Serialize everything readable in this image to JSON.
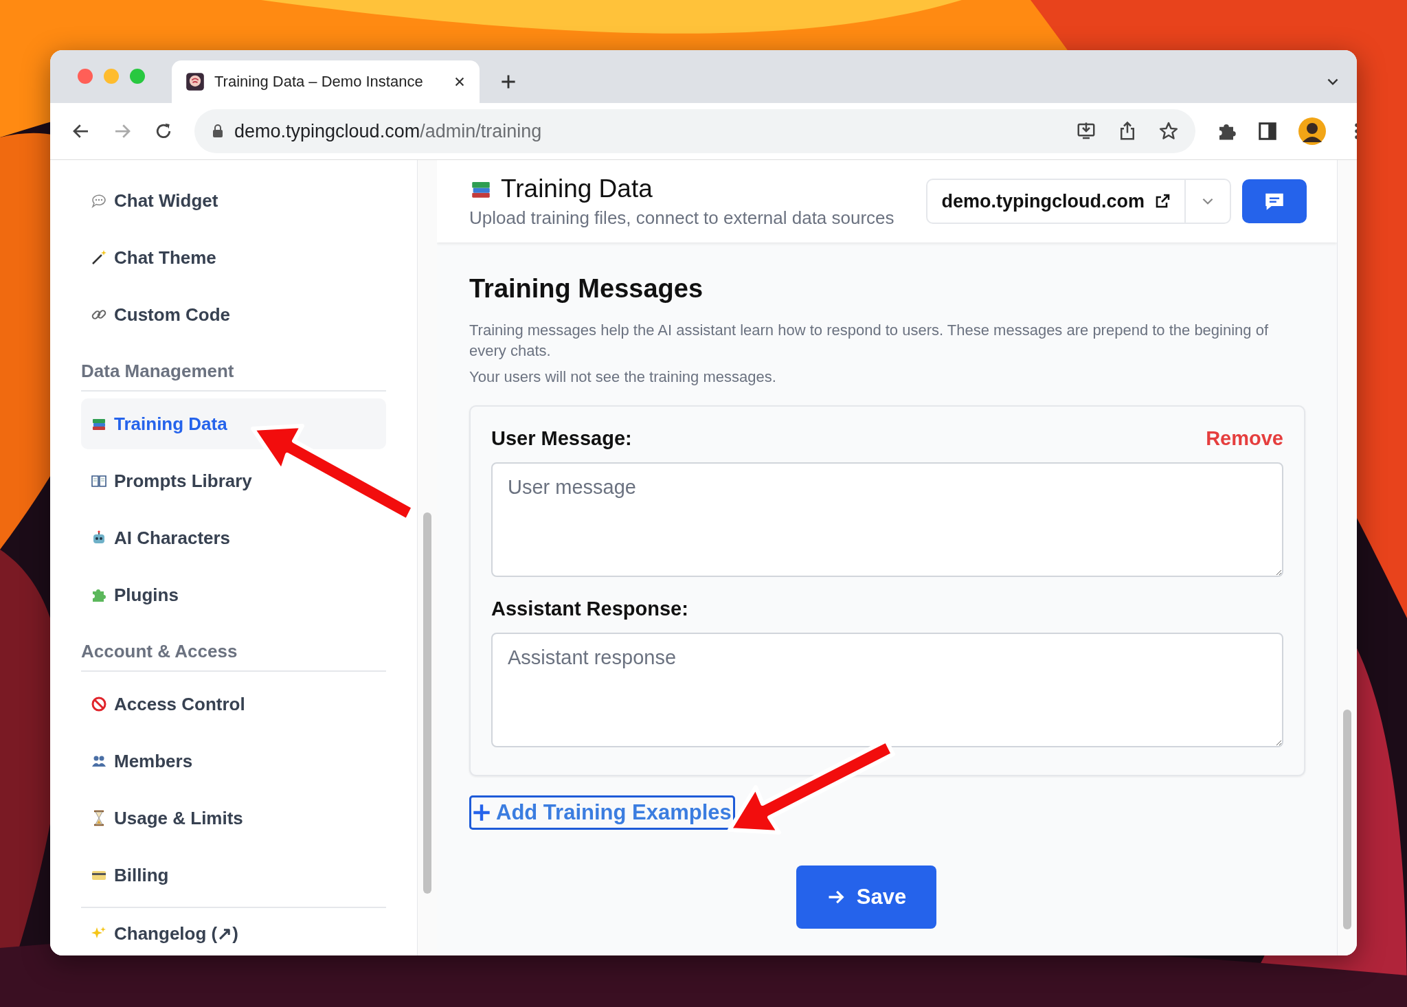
{
  "browser": {
    "tab": {
      "title": "Training Data – Demo Instance",
      "selected": true
    },
    "url": {
      "host": "demo.typingcloud.com",
      "path": "/admin/training"
    }
  },
  "sidebar": {
    "groups": [
      {
        "items": [
          {
            "label": "Chat Widget",
            "selected": false
          },
          {
            "label": "Chat Theme",
            "selected": false
          },
          {
            "label": "Custom Code",
            "selected": false
          }
        ]
      },
      {
        "heading": "Data Management",
        "items": [
          {
            "label": "Training Data",
            "selected": true
          },
          {
            "label": "Prompts Library",
            "selected": false
          },
          {
            "label": "AI Characters",
            "selected": false
          },
          {
            "label": "Plugins",
            "selected": false
          }
        ]
      },
      {
        "heading": "Account & Access",
        "items": [
          {
            "label": "Access Control",
            "selected": false
          },
          {
            "label": "Members",
            "selected": false
          },
          {
            "label": "Usage & Limits",
            "selected": false
          },
          {
            "label": "Billing",
            "selected": false
          }
        ]
      },
      {
        "items": [
          {
            "label": "Changelog (↗)",
            "selected": false
          }
        ]
      }
    ]
  },
  "header": {
    "title": "Training Data",
    "subtitle": "Upload training files, connect to external data sources",
    "domain": "demo.typingcloud.com"
  },
  "section": {
    "title": "Training Messages",
    "paragraphs": [
      "Training messages help the AI assistant learn how to respond to users. These messages are prepend to the begining of every chats.",
      "Your users will not see the training messages."
    ]
  },
  "examples": [
    {
      "user_label": "User Message:",
      "remove": "Remove",
      "user_placeholder": "User message",
      "assistant_label": "Assistant Response:",
      "assistant_placeholder": "Assistant response"
    }
  ],
  "add_button": "Add Training Examples",
  "save_button": "Save"
}
